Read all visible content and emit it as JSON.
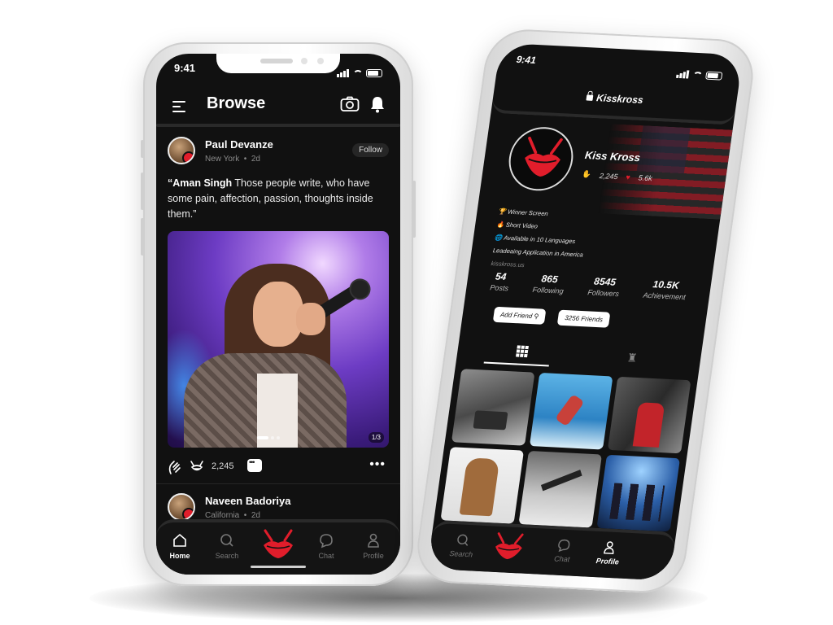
{
  "left_phone": {
    "status": {
      "time": "9:41"
    },
    "header": {
      "title": "Browse"
    },
    "post1": {
      "author": "Paul Devanze",
      "location": "New York",
      "age": "2d",
      "follow_label": "Follow",
      "quote_name": "“Aman Singh",
      "quote_text": " Those people write, who have some pain, affection, passion, thoughts inside them.”",
      "image_counter": "1/3",
      "like_count": "2,245"
    },
    "post2": {
      "author": "Naveen Badoriya",
      "location": "California",
      "age": "2d"
    },
    "tabbar": [
      {
        "label": "Home",
        "icon": "home-icon"
      },
      {
        "label": "Search",
        "icon": "search-icon"
      },
      {
        "label": "",
        "icon": "kiss-logo-icon"
      },
      {
        "label": "Chat",
        "icon": "chat-icon"
      },
      {
        "label": "Profile",
        "icon": "profile-icon"
      }
    ]
  },
  "right_phone": {
    "status": {
      "time": "9:41"
    },
    "header": {
      "title": "Kisskross"
    },
    "profile": {
      "name": "Kiss Kross",
      "likes": "2,245",
      "kisses": "5.6k",
      "bio": [
        "🏆 Winner Screen",
        "🔥 Short Video",
        "🌐 Available in 10 Languages",
        "Leadeaing Application in America"
      ],
      "link": "kisskross.us"
    },
    "stats": [
      {
        "value": "54",
        "label": "Posts"
      },
      {
        "value": "865",
        "label": "Following"
      },
      {
        "value": "8545",
        "label": "Followers"
      },
      {
        "value": "10.5K",
        "label": "Achievement"
      }
    ],
    "buttons": {
      "add_friend": "Add Friend",
      "friends": "3256 Friends"
    },
    "tabbar": [
      {
        "label": "Search",
        "icon": "search-icon"
      },
      {
        "label": "",
        "icon": "kiss-logo-icon"
      },
      {
        "label": "Chat",
        "icon": "chat-icon"
      },
      {
        "label": "Profile",
        "icon": "profile-icon"
      }
    ]
  },
  "colors": {
    "accent": "#e11d2b",
    "screen_bg": "#111111",
    "text": "#ffffff"
  }
}
